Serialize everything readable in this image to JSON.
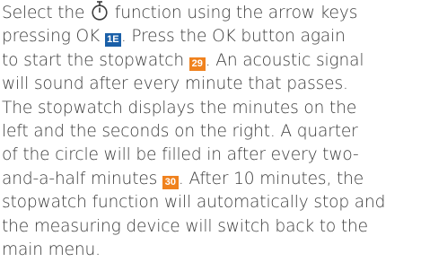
{
  "paragraph": {
    "line1_before": "Select the ",
    "line1_after": " function using the arrow keys",
    "line2_before": "pressing OK ",
    "line2_after": ". Press the OK button again",
    "line3_before": "to start the stopwatch ",
    "line3_after": ". An acoustic signal",
    "line4": "will sound after every minute that passes.",
    "line5": "The stopwatch displays the minutes on the",
    "line6": "left and the seconds on the right. A quarter",
    "line7": "of the circle will be filled in after every two-",
    "line8_before": "and-a-half minutes ",
    "line8_after": ". After 10 minutes, the",
    "line9": "stopwatch function will automatically stop and",
    "line10": "the measuring device will switch back to the",
    "line11": "main menu."
  },
  "badges": {
    "ok_ref": "1E",
    "start_ref": "29",
    "quarter_ref": "30"
  },
  "icons": {
    "function_icon": "stopwatch-icon"
  },
  "colors": {
    "text": "#3c3c3c",
    "badge_blue": "#1a5fa8",
    "badge_orange": "#f0821e"
  }
}
